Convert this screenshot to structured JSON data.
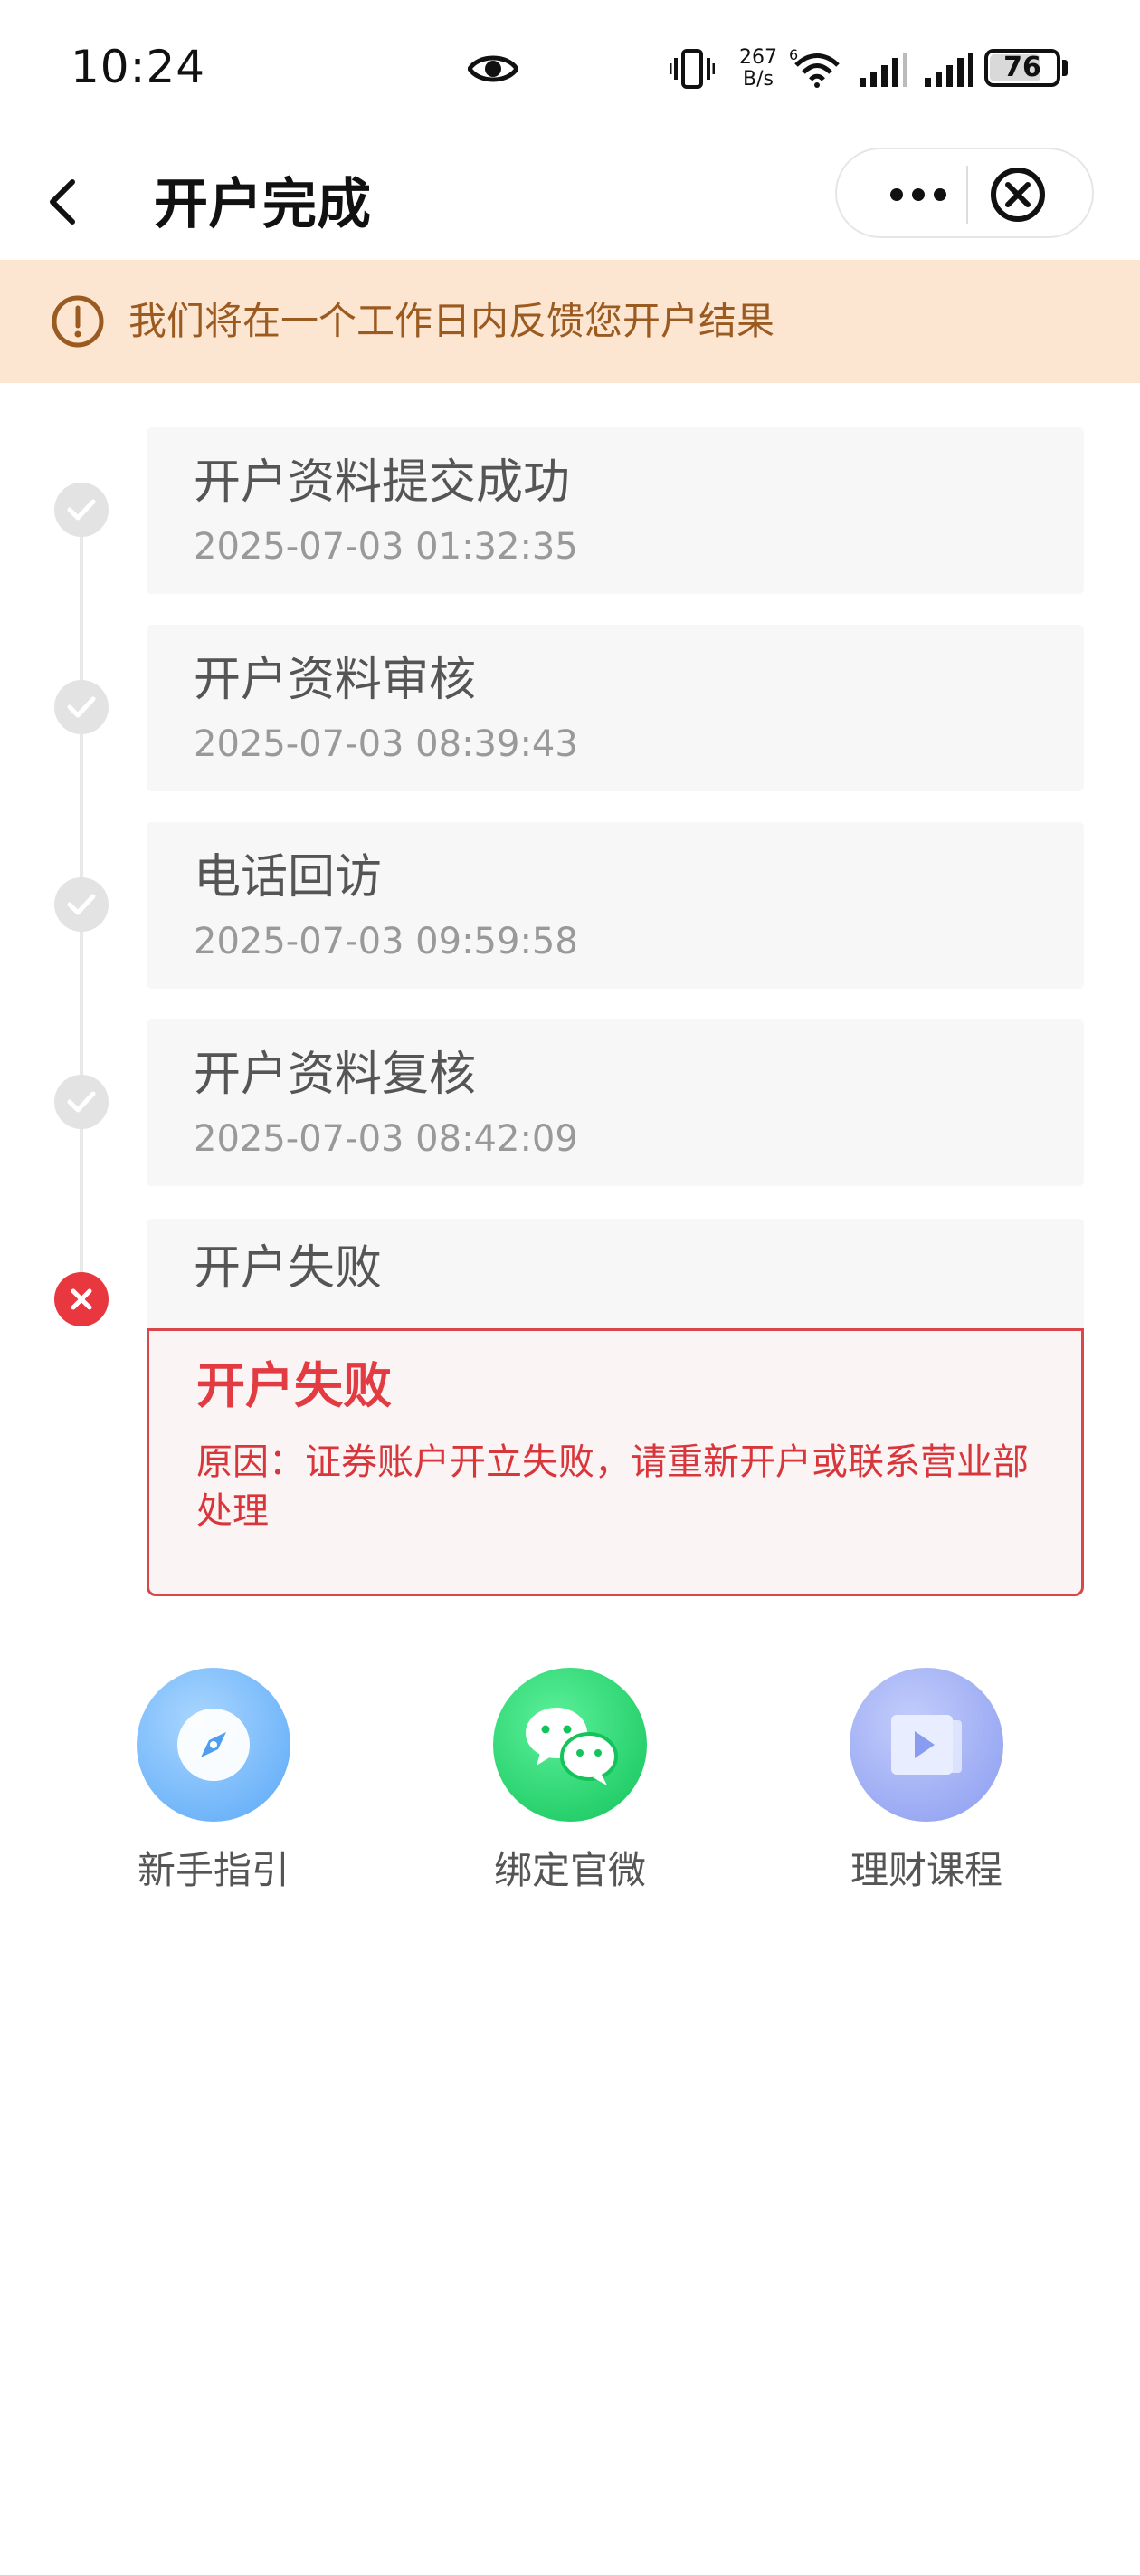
{
  "status_bar": {
    "time": "10:24",
    "net_speed_value": "267",
    "net_speed_unit": "B/s",
    "battery": "76",
    "icons": [
      "eye-icon",
      "vibrate-icon",
      "wifi-icon",
      "signal-icon",
      "signal-icon",
      "battery-icon"
    ]
  },
  "nav": {
    "title": "开户完成",
    "back_icon": "chevron-left-icon",
    "more_icon": "more-dots-icon",
    "close_icon": "close-circle-icon"
  },
  "notice": {
    "icon": "exclamation-circle-icon",
    "text": "我们将在一个工作日内反馈您开户结果",
    "color": "#9a5a20",
    "background": "#fde6d1"
  },
  "steps": [
    {
      "title": "开户资料提交成功",
      "time": "2025-07-03 01:32:35",
      "status": "done"
    },
    {
      "title": "开户资料审核",
      "time": "2025-07-03 08:39:43",
      "status": "done"
    },
    {
      "title": "电话回访",
      "time": "2025-07-03 09:59:58",
      "status": "done"
    },
    {
      "title": "开户资料复核",
      "time": "2025-07-03 08:42:09",
      "status": "done"
    },
    {
      "title": "开户失败",
      "time": "",
      "status": "failed"
    }
  ],
  "failure": {
    "title": "开户失败",
    "reason": "原因：证券账户开立失败，请重新开户或联系营业部处理",
    "color": "#e23b41"
  },
  "shortcuts": [
    {
      "label": "新手指引",
      "icon": "compass-icon"
    },
    {
      "label": "绑定官微",
      "icon": "wechat-icon"
    },
    {
      "label": "理财课程",
      "icon": "video-course-icon"
    }
  ]
}
